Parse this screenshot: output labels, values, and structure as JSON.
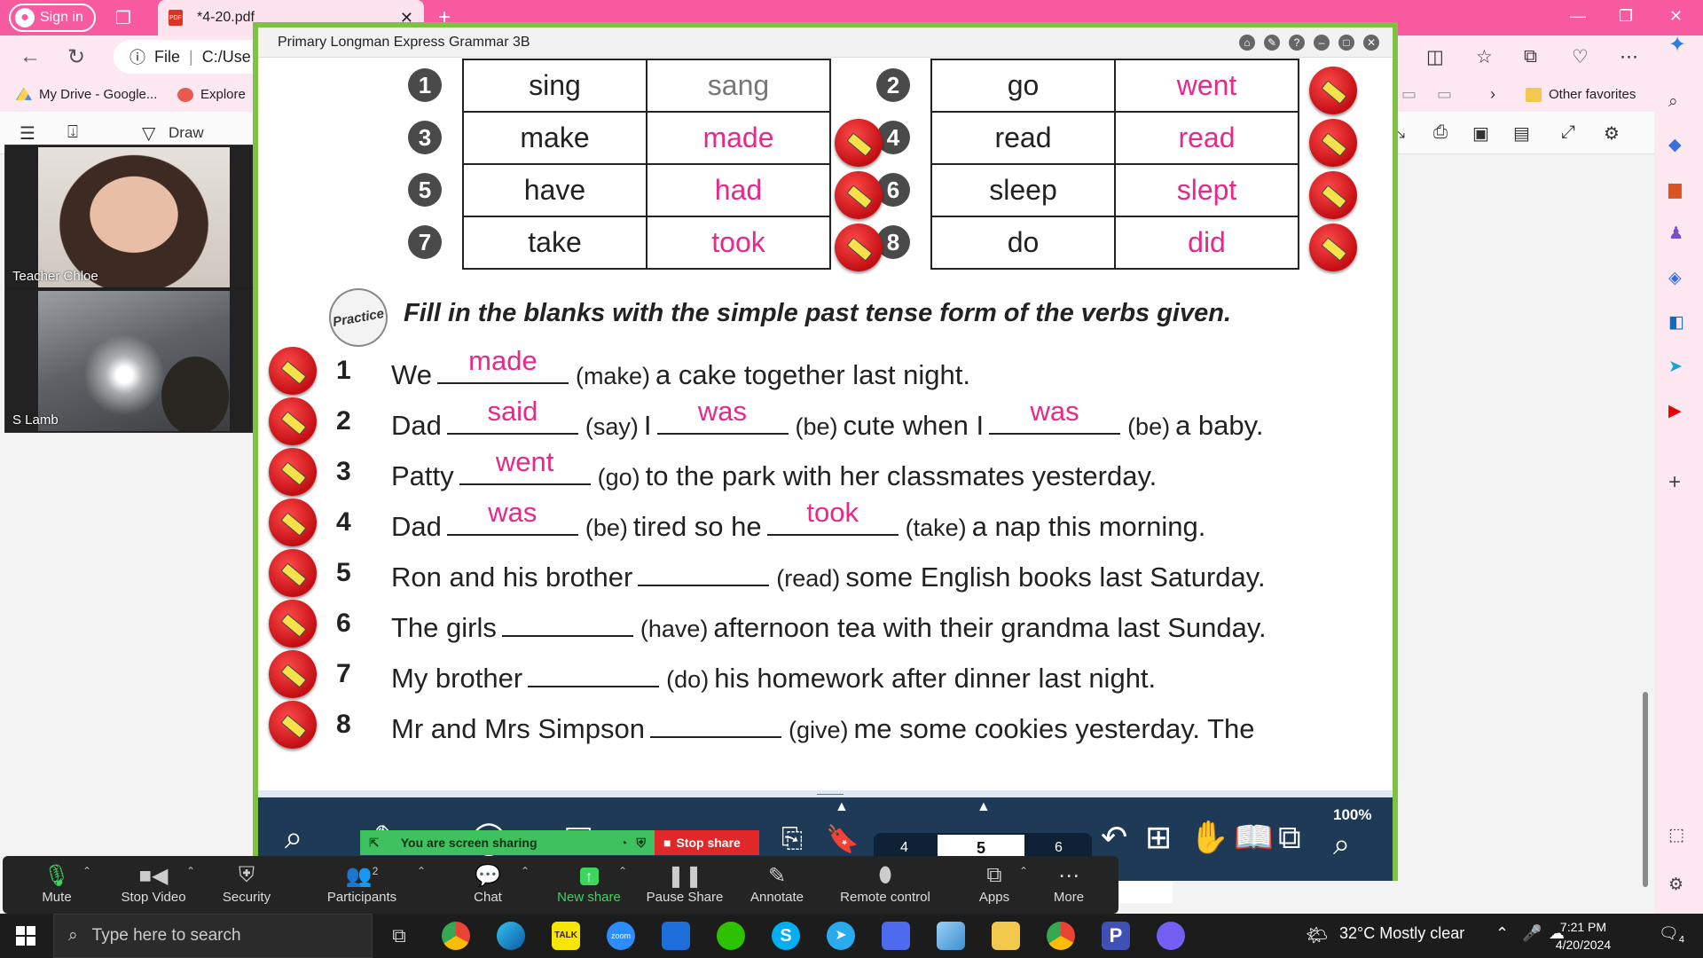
{
  "browser": {
    "signin_label": "Sign in",
    "tab_title": "*4-20.pdf",
    "tab_close": "✕",
    "new_tab": "+",
    "address_prefix": "File",
    "address_text": "C:/Use",
    "accent": "#f85a9f"
  },
  "favorites": {
    "items": [
      {
        "label": "My Drive - Google..."
      },
      {
        "label": "Explore"
      }
    ],
    "other_label": "Other favorites"
  },
  "pdf_toolbar": {
    "draw_label": "Draw"
  },
  "video": {
    "participants": [
      {
        "name": "Teacher Chloe"
      },
      {
        "name": "S Lamb"
      }
    ]
  },
  "reader": {
    "title": "Primary Longman Express Grammar 3B",
    "verb_table": {
      "rows": [
        {
          "n1": "1",
          "base1": "sing",
          "past1": "sang",
          "n2": "2",
          "base2": "go",
          "past2": "went"
        },
        {
          "n1": "3",
          "base1": "make",
          "past1": "made",
          "n2": "4",
          "base2": "read",
          "past2": "read"
        },
        {
          "n1": "5",
          "base1": "have",
          "past1": "had",
          "n2": "6",
          "base2": "sleep",
          "past2": "slept"
        },
        {
          "n1": "7",
          "base1": "take",
          "past1": "took",
          "n2": "8",
          "base2": "do",
          "past2": "did"
        }
      ]
    },
    "practice_badge": "Practice",
    "instruction": "Fill in the blanks with the simple past tense form of the verbs given.",
    "exercises": [
      {
        "n": "1",
        "p1": "We",
        "a1": "made",
        "h1": "(make)",
        "p2": "a cake together last night."
      },
      {
        "n": "2",
        "p1": "Dad",
        "a1": "said",
        "h1": "(say)",
        "p2": "I",
        "a2": "was",
        "h2": "(be)",
        "p3": "cute when I",
        "a3": "was",
        "h3": "(be)",
        "p4": "a baby."
      },
      {
        "n": "3",
        "p1": "Patty",
        "a1": "went",
        "h1": "(go)",
        "p2": "to the park with her classmates yesterday."
      },
      {
        "n": "4",
        "p1": "Dad",
        "a1": "was",
        "h1": "(be)",
        "p2": "tired so he",
        "a2": "took",
        "h2": "(take)",
        "p3": "a nap this morning."
      },
      {
        "n": "5",
        "p1": "Ron and his brother",
        "a1": "",
        "h1": "(read)",
        "p2": "some English books last Saturday."
      },
      {
        "n": "6",
        "p1": "The girls",
        "a1": "",
        "h1": "(have)",
        "p2": "afternoon tea with their grandma last Sunday."
      },
      {
        "n": "7",
        "p1": "My brother",
        "a1": "",
        "h1": "(do)",
        "p2": "his homework after dinner last night."
      },
      {
        "n": "8",
        "p1": "Mr and Mrs Simpson",
        "a1": "",
        "h1": "(give)",
        "p2": "me some cookies yesterday. The"
      }
    ],
    "pager": {
      "prev": "4",
      "current": "5",
      "next": "6"
    },
    "zoom_level": "100%",
    "answer_color": "#e6298a",
    "frame_color": "#7dc242"
  },
  "zoom": {
    "share_status": "You are screen sharing",
    "stop_share": "Stop share",
    "participants_count": "2",
    "controls": [
      {
        "label": "Mute"
      },
      {
        "label": "Stop Video"
      },
      {
        "label": "Security"
      },
      {
        "label": "Participants"
      },
      {
        "label": "Chat"
      },
      {
        "label": "New share"
      },
      {
        "label": "Pause Share"
      },
      {
        "label": "Annotate"
      },
      {
        "label": "Remote control"
      },
      {
        "label": "Apps"
      },
      {
        "label": "More"
      }
    ]
  },
  "taskbar": {
    "search_placeholder": "Type here to search",
    "weather": "32°C  Mostly clear",
    "time": "7:21 PM",
    "date": "4/20/2024",
    "notifications": "4"
  }
}
